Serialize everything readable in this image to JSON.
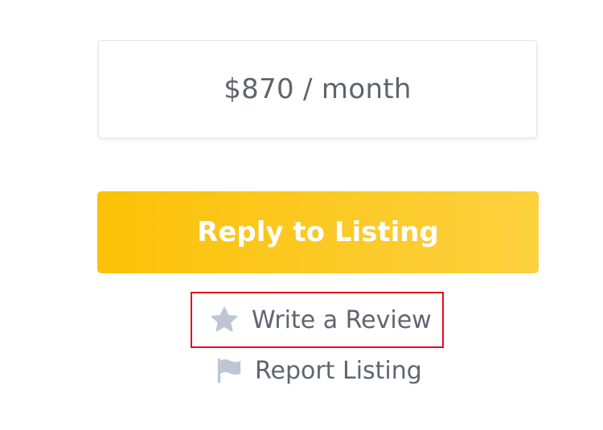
{
  "listing": {
    "price_text": "$870 / month"
  },
  "actions": {
    "reply_label": "Reply to Listing",
    "review_label": "Write a Review",
    "report_label": "Report Listing"
  },
  "icons": {
    "review": "star-icon",
    "report": "flag-icon"
  },
  "colors": {
    "accent_start": "#fcc107",
    "accent_end": "#fdd13f",
    "icon_color": "#bfc6d3",
    "text_color": "#5f6670",
    "highlight_border": "#e30b1c"
  }
}
